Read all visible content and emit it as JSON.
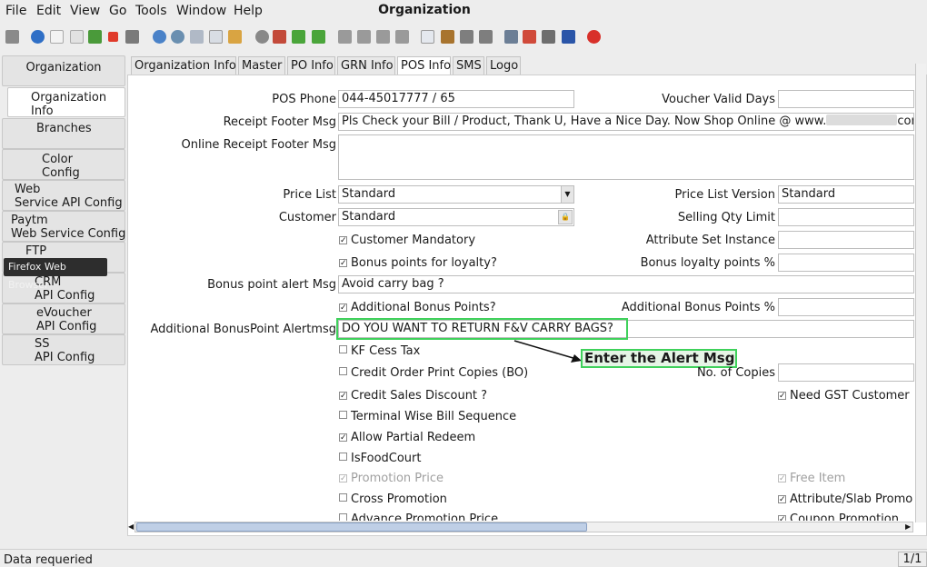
{
  "menu": {
    "file": "File",
    "edit": "Edit",
    "view": "View",
    "go": "Go",
    "tools": "Tools",
    "window": "Window",
    "help": "Help"
  },
  "window_title": "Organization",
  "left_tabs": [
    {
      "label": "Organization"
    },
    {
      "label": "Organization\nInfo"
    },
    {
      "label": "Branches"
    },
    {
      "label": "Color\nConfig"
    },
    {
      "label": "Web\nService API Config"
    },
    {
      "label": "Paytm\nWeb Service Config"
    },
    {
      "label": "FTP"
    },
    {
      "label": "CRM\nAPI Config"
    },
    {
      "label": "eVoucher\nAPI Config"
    },
    {
      "label": "SS\nAPI Config"
    }
  ],
  "tooltip": "Firefox Web Browser",
  "top_tabs": [
    "Organization Info",
    "Master",
    "PO Info",
    "GRN Info",
    "POS Info",
    "SMS",
    "Logo"
  ],
  "form": {
    "pos_phone": {
      "label": "POS Phone",
      "value": "044-45017777  / 65"
    },
    "voucher_valid_days": {
      "label": "Voucher Valid Days",
      "value": ""
    },
    "receipt_footer": {
      "label": "Receipt Footer Msg",
      "value_before": "Pls Check your Bill / Product, Thank U, Have a Nice Day. Now Shop Online @ www.",
      "value_after": "com"
    },
    "online_footer": {
      "label": "Online Receipt Footer Msg",
      "value": ""
    },
    "price_list": {
      "label": "Price List",
      "value": "Standard"
    },
    "price_list_version": {
      "label": "Price List Version",
      "value": "Standard"
    },
    "customer": {
      "label": "Customer",
      "value": "Standard"
    },
    "selling_qty_limit": {
      "label": "Selling Qty Limit",
      "value": ""
    },
    "customer_mandatory": {
      "label": "Customer Mandatory"
    },
    "attribute_set_instance": {
      "label": "Attribute Set Instance",
      "value": ""
    },
    "bonus_points": {
      "label": "Bonus points for loyalty?"
    },
    "bonus_loyalty_pct": {
      "label": "Bonus loyalty points %",
      "value": ""
    },
    "bonus_alert": {
      "label": "Bonus point alert Msg",
      "value": "Avoid carry bag ?"
    },
    "additional_bonus": {
      "label": "Additional Bonus Points?"
    },
    "additional_bonus_pct": {
      "label": "Additional Bonus Points %",
      "value": ""
    },
    "additional_alert": {
      "label": "Additional BonusPoint Alertmsg",
      "value": "DO YOU WANT TO RETURN F&V CARRY BAGS?"
    },
    "kf_cess": {
      "label": "KF Cess Tax"
    },
    "credit_order": {
      "label": "Credit Order Print Copies (BO)"
    },
    "no_of_copies": {
      "label": "No. of Copies",
      "value": ""
    },
    "credit_sales": {
      "label": "Credit Sales Discount ?"
    },
    "need_gst": {
      "label": "Need GST Customer In"
    },
    "terminal_wise": {
      "label": "Terminal Wise Bill Sequence"
    },
    "allow_partial": {
      "label": "Allow Partial Redeem"
    },
    "isfoodcourt": {
      "label": "IsFoodCourt"
    },
    "promotion_price": {
      "label": "Promotion Price"
    },
    "free_item": {
      "label": "Free Item"
    },
    "cross_promotion": {
      "label": "Cross Promotion"
    },
    "attribute_slab": {
      "label": "Attribute/Slab Promo"
    },
    "advance_promotion": {
      "label": "Advance Promotion Price"
    },
    "coupon_promotion": {
      "label": "Coupon Promotion"
    }
  },
  "annotation": "Enter the Alert Msg",
  "status": {
    "text": "Data requeried",
    "page": "1/1"
  },
  "colors": {
    "highlight": "#3fd15b"
  }
}
